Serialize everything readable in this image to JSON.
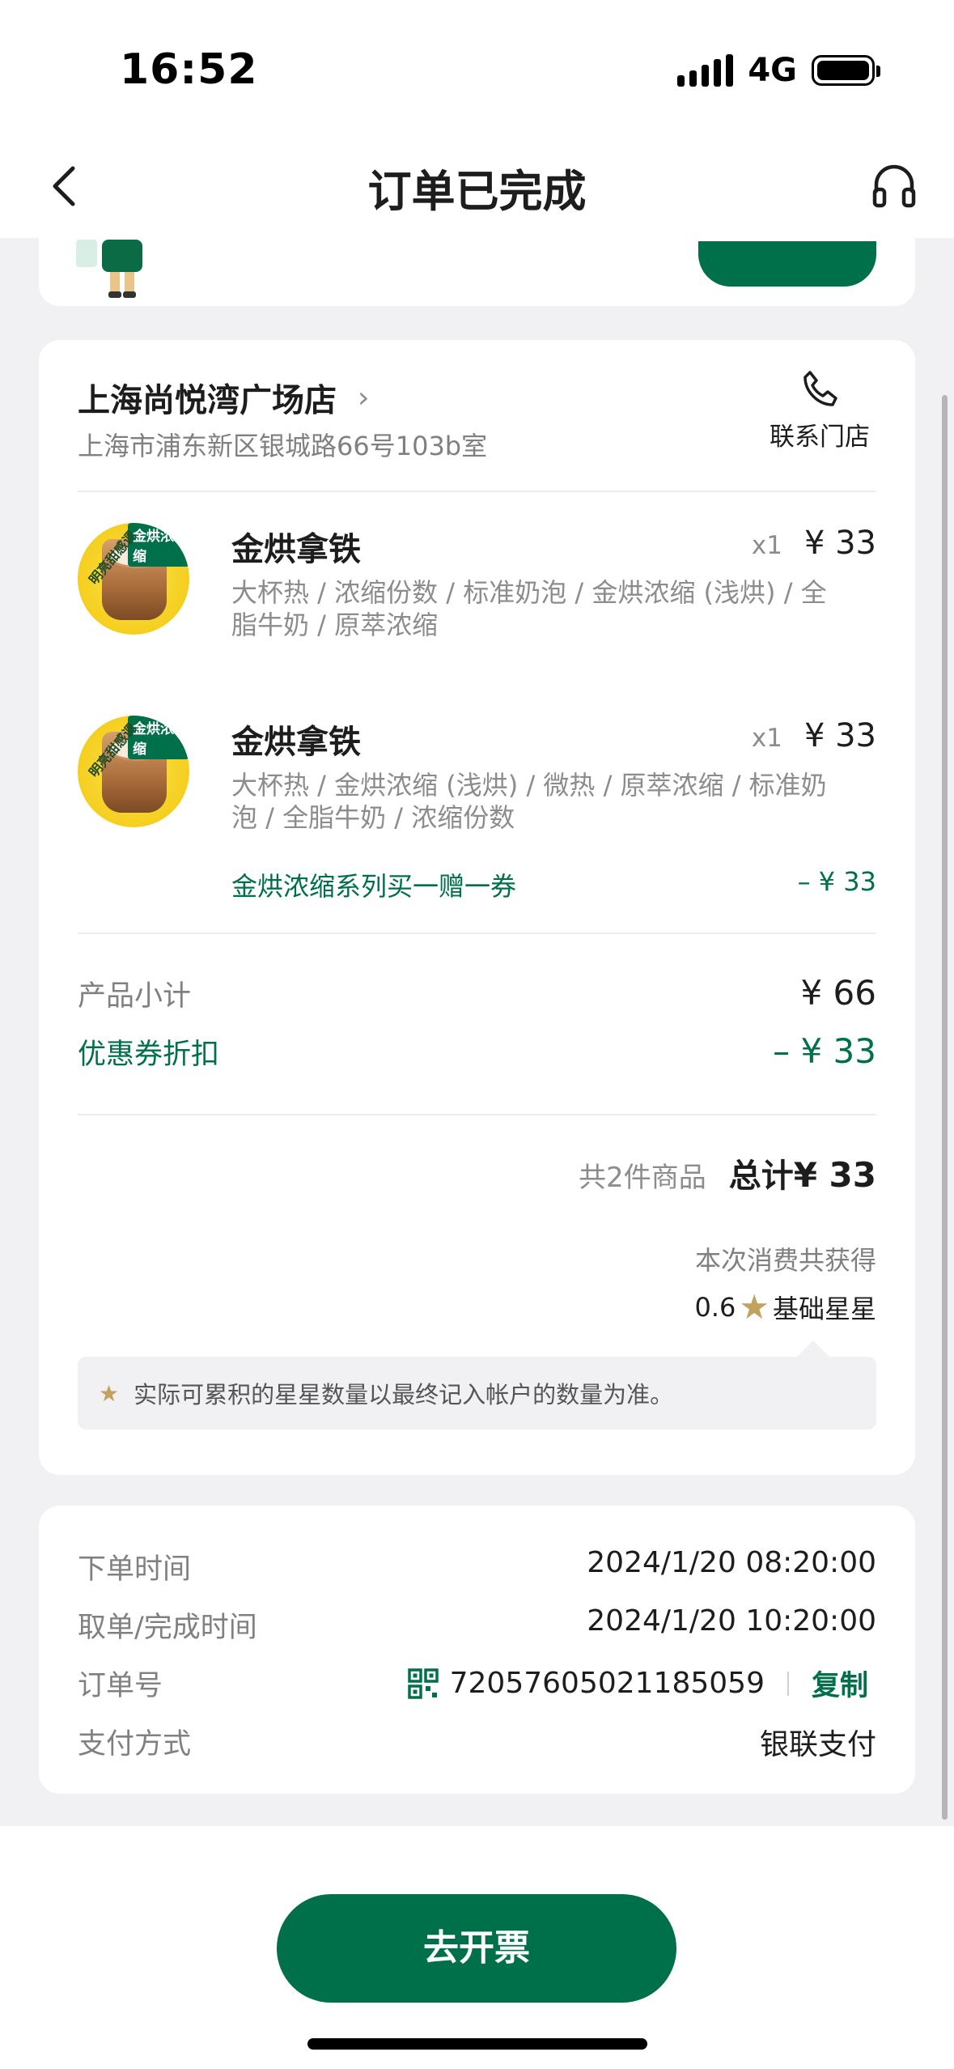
{
  "status_bar": {
    "time": "16:52",
    "network": "4G"
  },
  "nav": {
    "title": "订单已完成"
  },
  "store": {
    "name": "上海尚悦湾广场店",
    "address": "上海市浦东新区银城路66号103b室",
    "contact_label": "联系门店"
  },
  "products": [
    {
      "name": "金烘拿铁",
      "qty": "x1",
      "price": "¥ 33",
      "spec": "大杯热 / 浓缩份数 / 标准奶泡 / 金烘浓缩 (浅烘) / 全脂牛奶 / 原萃浓缩",
      "tag": "金烘浓缩",
      "side_text": "明亮甜感调"
    },
    {
      "name": "金烘拿铁",
      "qty": "x1",
      "price": "¥ 33",
      "spec": "大杯热 / 金烘浓缩 (浅烘) / 微热 / 原萃浓缩 / 标准奶泡 / 全脂牛奶 / 浓缩份数",
      "tag": "金烘浓缩",
      "side_text": "明亮甜感调",
      "coupon": "金烘浓缩系列买一赠一券",
      "coupon_amount": "– ¥ 33"
    }
  ],
  "summary": {
    "subtotal_label": "产品小计",
    "subtotal_value": "¥ 66",
    "discount_label": "优惠券折扣",
    "discount_value": "– ¥ 33",
    "item_count": "共2件商品",
    "total_label": "总计",
    "total_value": "¥ 33"
  },
  "stars": {
    "earned_label": "本次消费共获得",
    "amount": "0.6",
    "type_label": "基础星星",
    "note": "实际可累积的星星数量以最终记入帐户的数量为准。"
  },
  "order_info": {
    "order_time_label": "下单时间",
    "order_time_value": "2024/1/20 08:20:00",
    "pickup_time_label": "取单/完成时间",
    "pickup_time_value": "2024/1/20 10:20:00",
    "order_no_label": "订单号",
    "order_no_value": "72057605021185059",
    "copy_label": "复制",
    "payment_label": "支付方式",
    "payment_value": "银联支付"
  },
  "actions": {
    "invoice_label": "去开票"
  },
  "colors": {
    "brand_green": "#00704a",
    "star_gold": "#c3a15e",
    "page_bg": "#f1f1f3"
  }
}
